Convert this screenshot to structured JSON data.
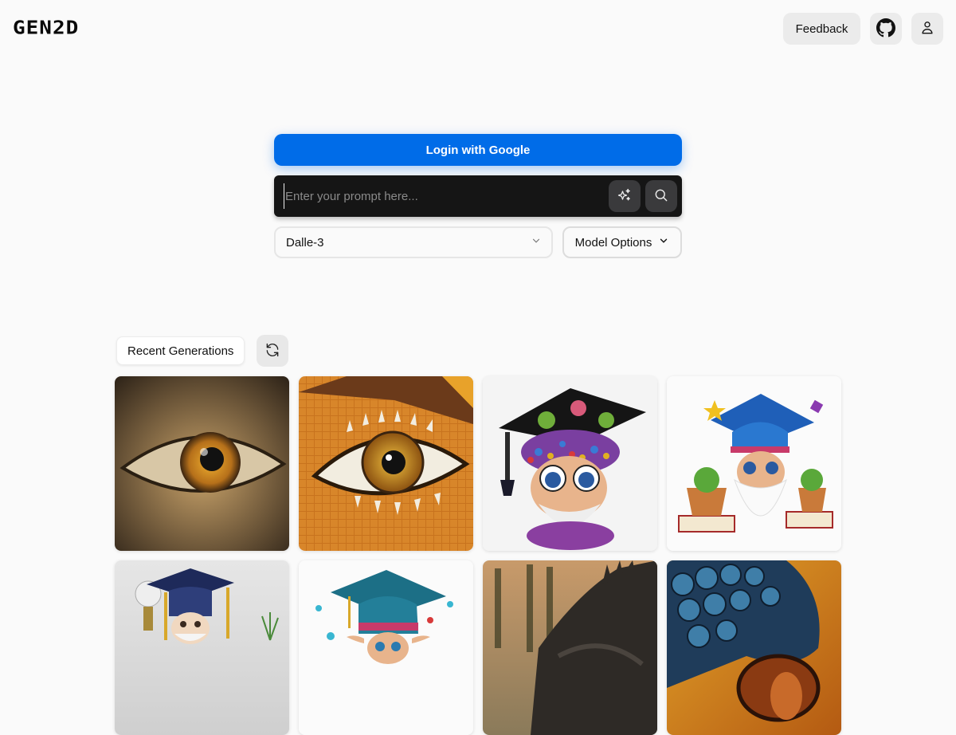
{
  "header": {
    "logo": "GEN2D",
    "feedback_label": "Feedback",
    "github_icon": "github-icon",
    "profile_icon": "user-icon"
  },
  "auth": {
    "login_label": "Login with Google"
  },
  "prompt": {
    "value": "",
    "placeholder": "Enter your prompt here...",
    "enhance_icon": "sparkles-icon",
    "search_icon": "search-icon"
  },
  "options": {
    "model_selected": "Dalle-3",
    "model_options_label": "Model Options"
  },
  "recent": {
    "label": "Recent Generations",
    "refresh_icon": "refresh-icon"
  },
  "gallery": [
    {
      "subject": "Realistic reptile eye close-up",
      "palette": [
        "#5a4a32",
        "#c9a36a",
        "#2a1f12",
        "#d89a2a"
      ]
    },
    {
      "subject": "Mosaic-tile reptile eye with spikes",
      "palette": [
        "#c8731e",
        "#6b3a1a",
        "#f2ede0",
        "#e0a42a"
      ]
    },
    {
      "subject": "Jeweled gnome with graduation cap and succulents",
      "palette": [
        "#ffffff",
        "#111111",
        "#3a7bd5",
        "#e8b48c"
      ]
    },
    {
      "subject": "Gnome with blue graduation cap, books and plants",
      "palette": [
        "#ffffff",
        "#1f5fb8",
        "#f3f3f3",
        "#c97a3a"
      ]
    },
    {
      "subject": "Gnome figurine with navy graduation cap",
      "palette": [
        "#dcdcdc",
        "#1e2a5a",
        "#c9a34a",
        "#f1e0d0"
      ]
    },
    {
      "subject": "Gnome with teal graduation cap and gems",
      "palette": [
        "#ffffff",
        "#1c6f86",
        "#39b6d1",
        "#e8b48c"
      ]
    },
    {
      "subject": "Dark reptile head against sunset forest",
      "palette": [
        "#c89a6a",
        "#2e2a26",
        "#6b5e50",
        "#1d2a1a"
      ]
    },
    {
      "subject": "Blue-scaled reptile eye at sunset",
      "palette": [
        "#e2a22a",
        "#1f3c5a",
        "#3f7ea8",
        "#8a3a12"
      ]
    }
  ]
}
